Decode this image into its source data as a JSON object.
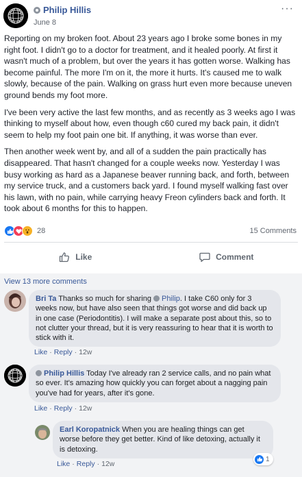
{
  "post": {
    "author": "Philip Hillis",
    "date": "June 8",
    "menu_glyph": "···",
    "paragraphs": [
      "Reporting on my broken foot. About 23 years ago I broke some bones in my right foot. I didn't go to a doctor for treatment, and it healed poorly. At first it wasn't much of a problem, but over the years it has gotten worse. Walking has become painful. The more I'm on it, the more it hurts. It's caused me to walk slowly, because of the pain. Walking on grass hurt even more because uneven ground bends my foot more.",
      "I've been very active the last few months, and as recently as 3 weeks ago I was thinking to myself about how, even though c60 cured my back pain, it didn't seem to help my foot pain one bit. If anything, it was worse than ever.",
      "Then another week went by, and all of a sudden the pain practically has disappeared. That hasn't changed for a couple weeks now. Yesterday I was busy working as hard as a Japanese beaver running back, and forth, between my service truck, and a customers back yard. I found myself walking fast over his lawn, with no pain, while carrying heavy Freon cylinders back and forth. It took about 6 months for this to happen."
    ],
    "reaction_icons": [
      "like-icon",
      "love-icon",
      "wow-icon"
    ],
    "reaction_count": "28",
    "comment_count": "15 Comments"
  },
  "actions": {
    "like_label": "Like",
    "comment_label": "Comment"
  },
  "comments": {
    "view_more": "View 13 more comments",
    "items": [
      {
        "author": "Bri Ta",
        "text_before": " Thanks so much for sharing ",
        "mention": "Philip",
        "text_after": ". I take C60 only for 3 weeks now, but have also seen that things got worse and did back up in one case (Periodontitis). I will make a separate post about this, so to not clutter your thread, but it is very reassuring to hear that it is worth to stick with it.",
        "like": "Like",
        "reply": "Reply",
        "time": "12w"
      },
      {
        "author": "Philip Hillis",
        "text": " Today I've already ran 2 service calls, and no pain what so ever. It's amazing how quickly you can forget about a nagging pain you've had for years, after it's gone.",
        "like": "Like",
        "reply": "Reply",
        "time": "12w"
      },
      {
        "author": "Earl Koropatnick",
        "text": " When you are healing things can get worse before they get better. Kind of like detoxing, actually it is detoxing.",
        "like": "Like",
        "reply": "Reply",
        "time": "12w",
        "reaction_count": "1"
      }
    ]
  },
  "colors": {
    "link_blue": "#385898",
    "like_blue": "#1877f2",
    "love_red": "#f33e58",
    "wow_yellow": "#f7b125",
    "muted_gray": "#606770",
    "comment_bg": "#f2f3f5"
  }
}
